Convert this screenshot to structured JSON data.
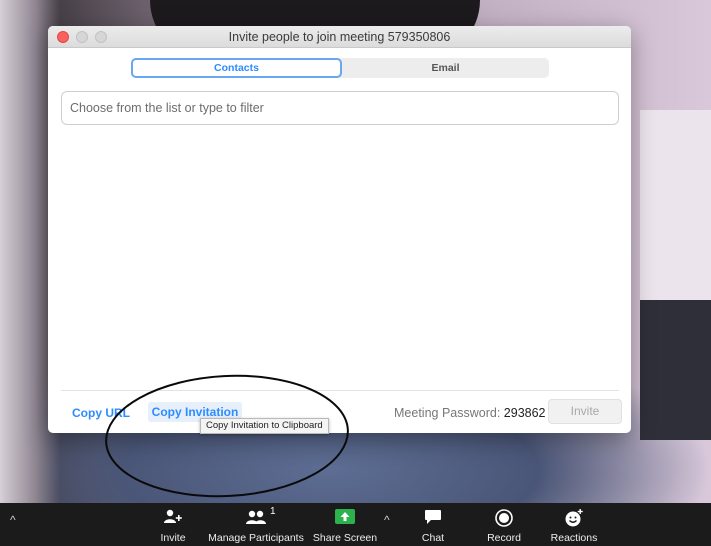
{
  "dialog": {
    "title": "Invite people to join meeting 579350806",
    "tabs": [
      {
        "label": "Contacts",
        "active": true
      },
      {
        "label": "Email",
        "active": false
      }
    ],
    "filter_placeholder": "Choose from the list or type to filter",
    "copy_url": "Copy URL",
    "copy_invitation": "Copy Invitation",
    "tooltip": "Copy Invitation to Clipboard",
    "password_label": "Meeting Password:",
    "password_value": "293862",
    "invite_button": "Invite"
  },
  "toolbar": {
    "invite": {
      "label": "Invite",
      "icon": "add-person-icon"
    },
    "participants": {
      "label": "Manage Participants",
      "count": "1",
      "icon": "participants-icon"
    },
    "share": {
      "label": "Share Screen",
      "icon": "share-screen-icon"
    },
    "chat": {
      "label": "Chat",
      "icon": "chat-icon"
    },
    "record": {
      "label": "Record",
      "icon": "record-icon"
    },
    "reactions": {
      "label": "Reactions",
      "icon": "emoji-icon"
    }
  },
  "colors": {
    "accent": "#2d8cff",
    "share_green": "#2bb24c",
    "toolbar_bg": "#1b1b1c"
  }
}
